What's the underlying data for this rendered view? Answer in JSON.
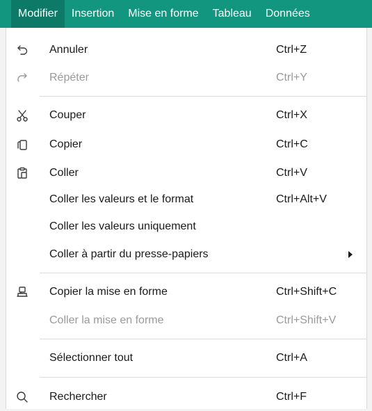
{
  "menubar": {
    "items": [
      {
        "label": "Modifier"
      },
      {
        "label": "Insertion"
      },
      {
        "label": "Mise en forme"
      },
      {
        "label": "Tableau"
      },
      {
        "label": "Données"
      }
    ]
  },
  "menu": {
    "items": [
      {
        "label": "Annuler",
        "shortcut": "Ctrl+Z",
        "icon": "undo-icon"
      },
      {
        "label": "Répéter",
        "shortcut": "Ctrl+Y",
        "icon": "redo-icon",
        "disabled": true
      },
      {
        "label": "Couper",
        "shortcut": "Ctrl+X",
        "icon": "scissors-icon"
      },
      {
        "label": "Copier",
        "shortcut": "Ctrl+C",
        "icon": "copy-icon"
      },
      {
        "label": "Coller",
        "shortcut": "Ctrl+V",
        "icon": "paste-icon"
      },
      {
        "label": "Coller les valeurs et le format",
        "shortcut": "Ctrl+Alt+V"
      },
      {
        "label": "Coller les valeurs uniquement",
        "shortcut": ""
      },
      {
        "label": "Coller à partir du presse-papiers",
        "shortcut": "",
        "submenu": true
      },
      {
        "label": "Copier la mise en forme",
        "shortcut": "Ctrl+Shift+C",
        "icon": "format-painter-icon"
      },
      {
        "label": "Coller la mise en forme",
        "shortcut": "Ctrl+Shift+V",
        "disabled": true
      },
      {
        "label": "Sélectionner tout",
        "shortcut": "Ctrl+A"
      },
      {
        "label": "Rechercher",
        "shortcut": "Ctrl+F",
        "icon": "search-icon"
      }
    ]
  },
  "colors": {
    "menubar_bg": "#13967f",
    "menubar_active_bg": "#0c7a67",
    "disabled_text": "#9a9a9a"
  }
}
